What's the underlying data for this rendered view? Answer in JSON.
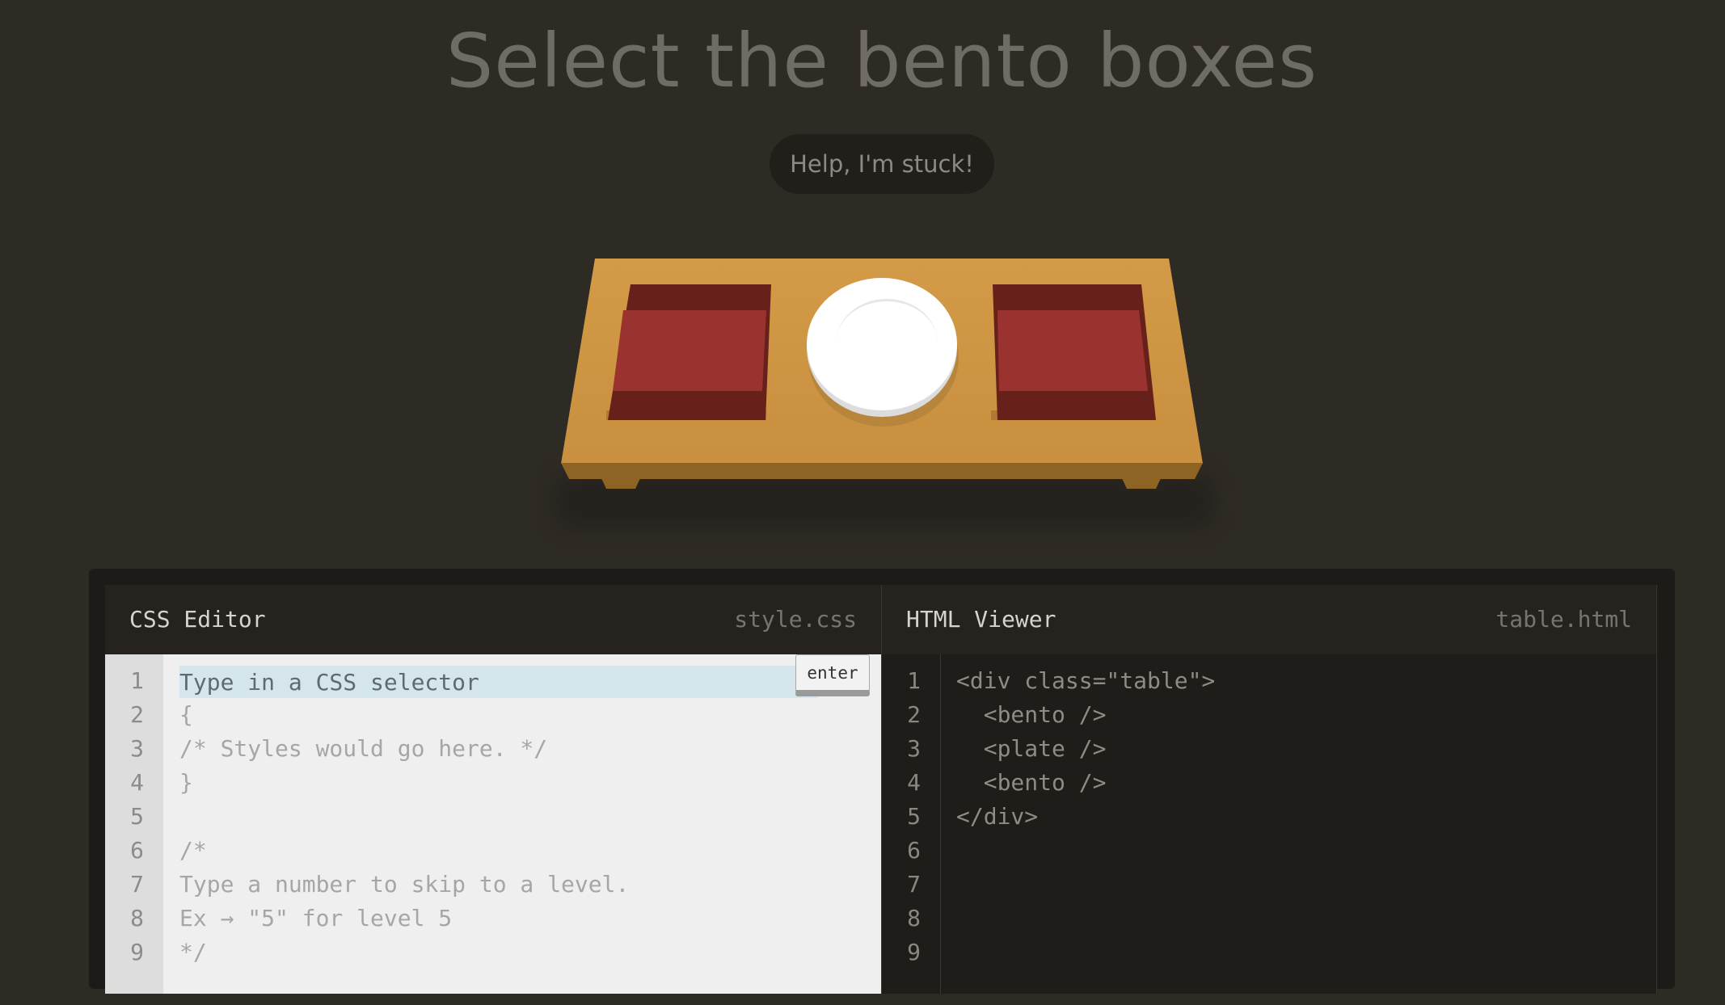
{
  "title": "Select the bento boxes",
  "help_button": "Help, I'm stuck!",
  "css_editor": {
    "title": "CSS Editor",
    "filename": "style.css",
    "input_placeholder": "Type in a CSS selector",
    "enter_label": "enter",
    "line_numbers": [
      "1",
      "2",
      "3",
      "4",
      "5",
      "6",
      "7",
      "8",
      "9"
    ],
    "lines": [
      "",
      "{",
      "/* Styles would go here. */",
      "}",
      "",
      "/*",
      "Type a number to skip to a level.",
      "Ex → \"5\" for level 5",
      "*/"
    ]
  },
  "html_viewer": {
    "title": "HTML Viewer",
    "filename": "table.html",
    "line_numbers": [
      "1",
      "2",
      "3",
      "4",
      "5",
      "6",
      "7",
      "8",
      "9"
    ],
    "lines": [
      "<div class=\"table\">",
      "  <bento />",
      "  <plate />",
      "  <bento />",
      "</div>",
      "",
      "",
      "",
      ""
    ]
  },
  "colors": {
    "background": "#2e2a24",
    "table": "#d39b47",
    "bento": "#67211a",
    "bento_inner": "#9a322f",
    "plate": "#ffffff",
    "input_highlight": "#d4e5ec"
  }
}
